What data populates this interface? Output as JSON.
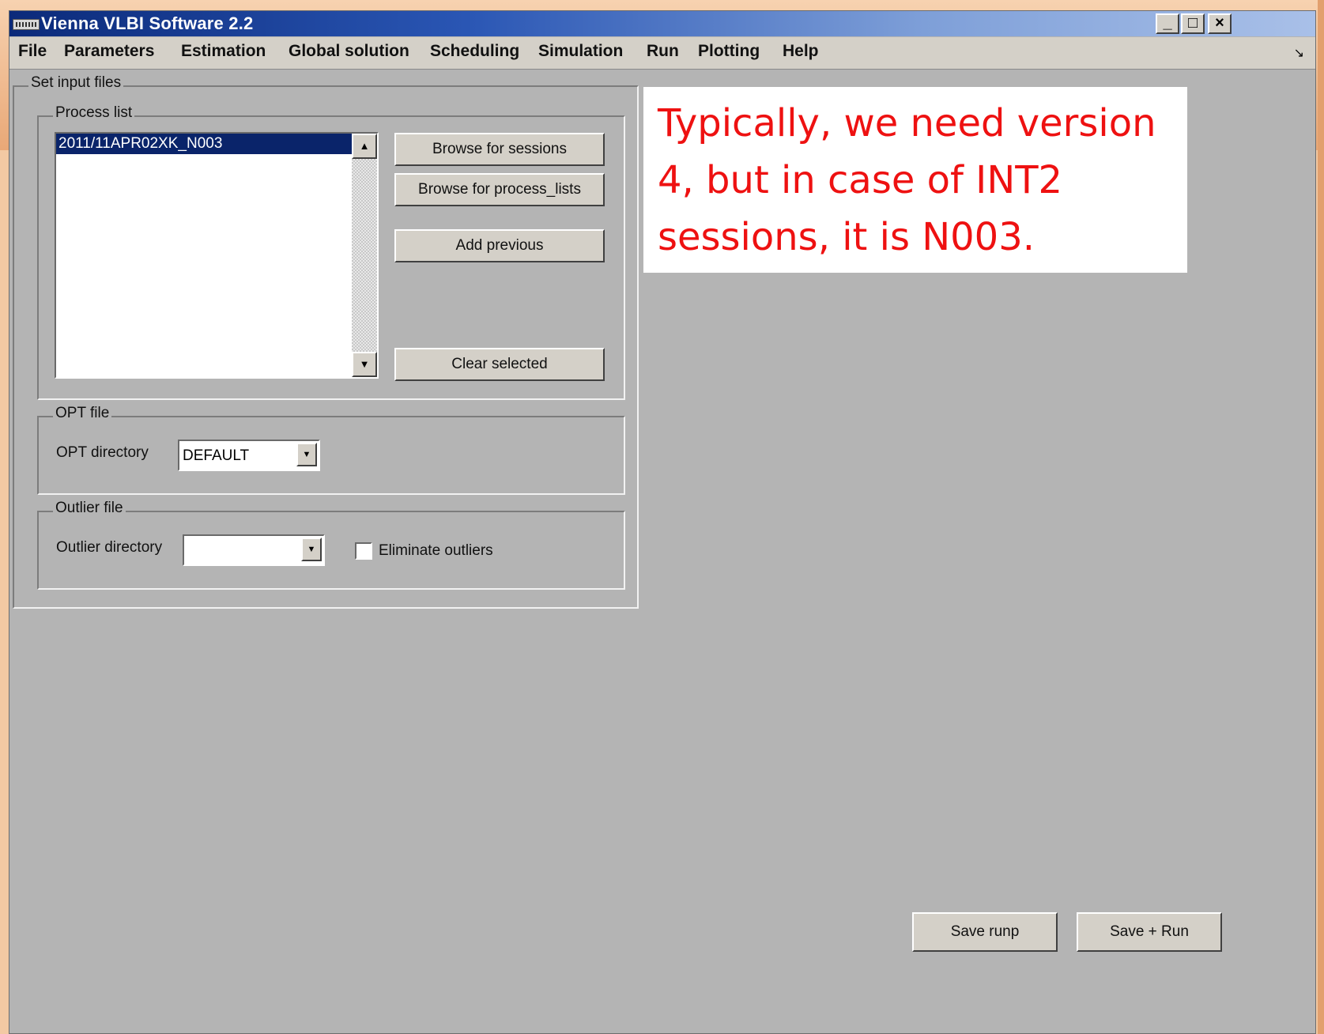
{
  "window": {
    "title": "Vienna VLBI Software 2.2",
    "controls": {
      "minimize": "_",
      "maximize": "□",
      "close": "×"
    }
  },
  "menu": {
    "items": [
      "File",
      "Parameters",
      "Estimation",
      "Global solution",
      "Scheduling",
      "Simulation",
      "Run",
      "Plotting",
      "Help"
    ],
    "overflow_glyph": "↘"
  },
  "set_input": {
    "label": "Set input files",
    "process_list": {
      "label": "Process list",
      "items": [
        "2011/11APR02XK_N003"
      ],
      "selected_index": 0,
      "buttons": {
        "browse_sessions": "Browse for sessions",
        "browse_process_lists": "Browse for process_lists",
        "add_previous": "Add previous",
        "clear_selected": "Clear selected"
      }
    },
    "opt_file": {
      "label": "OPT file",
      "dir_label": "OPT directory",
      "dir_value": "DEFAULT"
    },
    "outlier_file": {
      "label": "Outlier file",
      "dir_label": "Outlier directory",
      "dir_value": "",
      "eliminate_label": "Eliminate outliers",
      "eliminate_checked": false
    }
  },
  "footer": {
    "save_runp": "Save runp",
    "save_run": "Save + Run"
  },
  "annotation": {
    "text": "Typically, we need version 4, but in case of INT2 sessions, it is N003.",
    "color": "#ee1111"
  },
  "icons": {
    "app": "app-icon",
    "scroll_up": "scroll-up-arrow-icon",
    "scroll_down": "scroll-down-arrow-icon",
    "dropdown": "chevron-down-icon"
  }
}
